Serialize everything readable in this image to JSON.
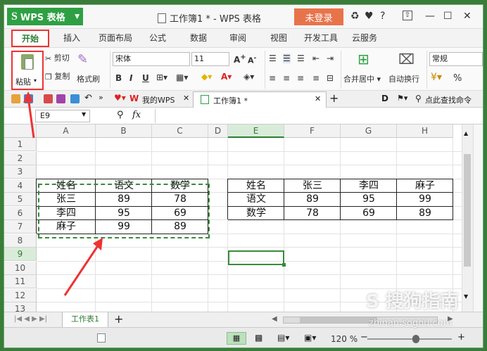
{
  "app": {
    "name": "WPS 表格",
    "doc_title": "工作簿1 * - WPS 表格",
    "login_label": "未登录"
  },
  "menu": {
    "tabs": [
      "开始",
      "插入",
      "页面布局",
      "公式",
      "数据",
      "审阅",
      "视图",
      "开发工具",
      "云服务"
    ]
  },
  "ribbon": {
    "paste": "粘贴",
    "cut": "剪切",
    "copy": "复制",
    "format_painter": "格式刷",
    "font_name": "宋体",
    "font_size": "11",
    "merge_center": "合并居中",
    "wrap_text": "自动换行",
    "number_format": "常规",
    "percent": "%"
  },
  "quickbar": {
    "my_wps": "我的WPS",
    "doc_tab": "工作簿1 *",
    "search_cmd": "点此查找命令"
  },
  "formula": {
    "name_box": "E9",
    "fx": "fx"
  },
  "grid": {
    "columns": [
      "A",
      "B",
      "C",
      "D",
      "E",
      "F",
      "G",
      "H"
    ],
    "rows": [
      "1",
      "2",
      "3",
      "4",
      "5",
      "6",
      "7",
      "8",
      "9",
      "10",
      "11",
      "12",
      "13"
    ],
    "left_table": [
      [
        "姓名",
        "语文",
        "数学"
      ],
      [
        "张三",
        "89",
        "78"
      ],
      [
        "李四",
        "95",
        "69"
      ],
      [
        "麻子",
        "99",
        "89"
      ]
    ],
    "right_table": [
      [
        "姓名",
        "张三",
        "李四",
        "麻子"
      ],
      [
        "语文",
        "89",
        "95",
        "99"
      ],
      [
        "数学",
        "78",
        "69",
        "89"
      ]
    ]
  },
  "sheets": {
    "active": "工作表1"
  },
  "status": {
    "zoom": "120 %"
  },
  "watermark": {
    "brand": "搜狗指南",
    "url": "zhinan.sogou.com"
  },
  "colors": {
    "accent": "#2ea043",
    "highlight": "#ee3333",
    "login": "#e8734a"
  }
}
